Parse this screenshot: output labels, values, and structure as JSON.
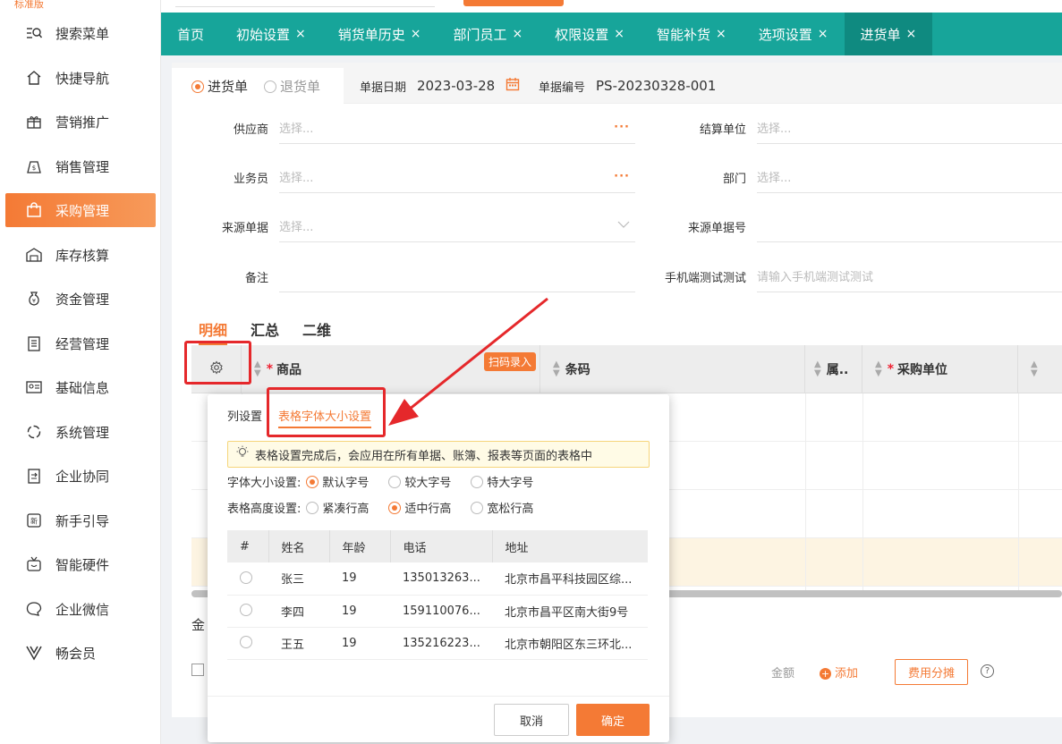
{
  "brand": "标准版",
  "sidebar": {
    "items": [
      {
        "label": "搜索菜单",
        "icon": "search-menu-icon"
      },
      {
        "label": "快捷导航",
        "icon": "home-icon"
      },
      {
        "label": "营销推广",
        "icon": "gift-icon"
      },
      {
        "label": "销售管理",
        "icon": "sales-bag-icon"
      },
      {
        "label": "采购管理",
        "icon": "shopping-bag-icon",
        "active": true
      },
      {
        "label": "库存核算",
        "icon": "warehouse-icon"
      },
      {
        "label": "资金管理",
        "icon": "money-bag-icon"
      },
      {
        "label": "经营管理",
        "icon": "clipboard-icon"
      },
      {
        "label": "基础信息",
        "icon": "id-card-icon"
      },
      {
        "label": "系统管理",
        "icon": "system-circle-icon"
      },
      {
        "label": "企业协同",
        "icon": "collaboration-icon"
      },
      {
        "label": "新手引导",
        "icon": "new-badge-icon"
      },
      {
        "label": "智能硬件",
        "icon": "tv-icon"
      },
      {
        "label": "企业微信",
        "icon": "chat-icon"
      },
      {
        "label": "畅会员",
        "icon": "vip-v-icon"
      }
    ]
  },
  "tabs": [
    {
      "label": "首页",
      "closable": false
    },
    {
      "label": "初始设置",
      "closable": true
    },
    {
      "label": "销货单历史",
      "closable": true
    },
    {
      "label": "部门员工",
      "closable": true
    },
    {
      "label": "权限设置",
      "closable": true
    },
    {
      "label": "智能补货",
      "closable": true
    },
    {
      "label": "选项设置",
      "closable": true
    },
    {
      "label": "进货单",
      "closable": true,
      "active": true
    }
  ],
  "doc": {
    "type_purchase": "进货单",
    "type_return": "退货单",
    "date_label": "单据日期",
    "date_value": "2023-03-28",
    "number_label": "单据编号",
    "number_value": "PS-20230328-001"
  },
  "form": {
    "supplier_label": "供应商",
    "supplier_placeholder": "选择...",
    "settle_label": "结算单位",
    "settle_placeholder": "选择...",
    "salesman_label": "业务员",
    "salesman_placeholder": "选择...",
    "dept_label": "部门",
    "dept_placeholder": "选择...",
    "source_doc_label": "来源单据",
    "source_doc_placeholder": "选择...",
    "source_no_label": "来源单据号",
    "remark_label": "备注",
    "mobile_label": "手机端测试测试",
    "mobile_placeholder": "请输入手机端测试测试"
  },
  "subtabs": [
    "明细",
    "汇总",
    "二维"
  ],
  "grid": {
    "col_product": "商品",
    "scan_badge": "扫码录入",
    "col_barcode": "条码",
    "col_attr": "属..",
    "col_unit": "采购单位"
  },
  "footer": {
    "amount_label_partial": "金",
    "amount_label": "金额",
    "add_label": "添加",
    "split_button": "费用分摊",
    "help_symbol": "?"
  },
  "popover": {
    "tab_columns": "列设置",
    "tab_font": "表格字体大小设置",
    "tip": "表格设置完成后，会应用在所有单据、账簿、报表等页面的表格中",
    "font_label": "字体大小设置:",
    "font_options": [
      "默认字号",
      "较大字号",
      "特大字号"
    ],
    "font_selected": 0,
    "height_label": "表格高度设置:",
    "height_options": [
      "紧凑行高",
      "适中行高",
      "宽松行高"
    ],
    "height_selected": 1,
    "table_headers": [
      "#",
      "姓名",
      "年龄",
      "电话",
      "地址"
    ],
    "table_rows": [
      [
        "张三",
        "19",
        "135013263...",
        "北京市昌平科技园区综..."
      ],
      [
        "李四",
        "19",
        "159110076...",
        "北京市昌平区南大街9号"
      ],
      [
        "王五",
        "19",
        "135216223...",
        "北京市朝阳区东三环北..."
      ]
    ],
    "cancel": "取消",
    "ok": "确定"
  },
  "colors": {
    "accent": "#f47a35",
    "tabbar": "#17a59a",
    "annotation": "#e5282b"
  }
}
